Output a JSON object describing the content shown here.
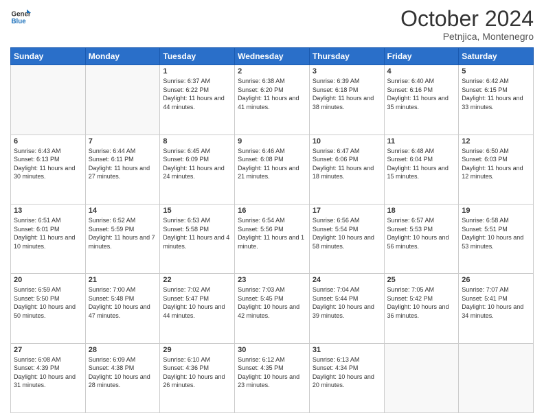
{
  "header": {
    "logo_line1": "General",
    "logo_line2": "Blue",
    "title": "October 2024",
    "location": "Petnjica, Montenegro"
  },
  "weekdays": [
    "Sunday",
    "Monday",
    "Tuesday",
    "Wednesday",
    "Thursday",
    "Friday",
    "Saturday"
  ],
  "weeks": [
    [
      {
        "day": "",
        "empty": true
      },
      {
        "day": "",
        "empty": true
      },
      {
        "day": "1",
        "sunrise": "6:37 AM",
        "sunset": "6:22 PM",
        "daylight": "11 hours and 44 minutes."
      },
      {
        "day": "2",
        "sunrise": "6:38 AM",
        "sunset": "6:20 PM",
        "daylight": "11 hours and 41 minutes."
      },
      {
        "day": "3",
        "sunrise": "6:39 AM",
        "sunset": "6:18 PM",
        "daylight": "11 hours and 38 minutes."
      },
      {
        "day": "4",
        "sunrise": "6:40 AM",
        "sunset": "6:16 PM",
        "daylight": "11 hours and 35 minutes."
      },
      {
        "day": "5",
        "sunrise": "6:42 AM",
        "sunset": "6:15 PM",
        "daylight": "11 hours and 33 minutes."
      }
    ],
    [
      {
        "day": "6",
        "sunrise": "6:43 AM",
        "sunset": "6:13 PM",
        "daylight": "11 hours and 30 minutes."
      },
      {
        "day": "7",
        "sunrise": "6:44 AM",
        "sunset": "6:11 PM",
        "daylight": "11 hours and 27 minutes."
      },
      {
        "day": "8",
        "sunrise": "6:45 AM",
        "sunset": "6:09 PM",
        "daylight": "11 hours and 24 minutes."
      },
      {
        "day": "9",
        "sunrise": "6:46 AM",
        "sunset": "6:08 PM",
        "daylight": "11 hours and 21 minutes."
      },
      {
        "day": "10",
        "sunrise": "6:47 AM",
        "sunset": "6:06 PM",
        "daylight": "11 hours and 18 minutes."
      },
      {
        "day": "11",
        "sunrise": "6:48 AM",
        "sunset": "6:04 PM",
        "daylight": "11 hours and 15 minutes."
      },
      {
        "day": "12",
        "sunrise": "6:50 AM",
        "sunset": "6:03 PM",
        "daylight": "11 hours and 12 minutes."
      }
    ],
    [
      {
        "day": "13",
        "sunrise": "6:51 AM",
        "sunset": "6:01 PM",
        "daylight": "11 hours and 10 minutes."
      },
      {
        "day": "14",
        "sunrise": "6:52 AM",
        "sunset": "5:59 PM",
        "daylight": "11 hours and 7 minutes."
      },
      {
        "day": "15",
        "sunrise": "6:53 AM",
        "sunset": "5:58 PM",
        "daylight": "11 hours and 4 minutes."
      },
      {
        "day": "16",
        "sunrise": "6:54 AM",
        "sunset": "5:56 PM",
        "daylight": "11 hours and 1 minute."
      },
      {
        "day": "17",
        "sunrise": "6:56 AM",
        "sunset": "5:54 PM",
        "daylight": "10 hours and 58 minutes."
      },
      {
        "day": "18",
        "sunrise": "6:57 AM",
        "sunset": "5:53 PM",
        "daylight": "10 hours and 56 minutes."
      },
      {
        "day": "19",
        "sunrise": "6:58 AM",
        "sunset": "5:51 PM",
        "daylight": "10 hours and 53 minutes."
      }
    ],
    [
      {
        "day": "20",
        "sunrise": "6:59 AM",
        "sunset": "5:50 PM",
        "daylight": "10 hours and 50 minutes."
      },
      {
        "day": "21",
        "sunrise": "7:00 AM",
        "sunset": "5:48 PM",
        "daylight": "10 hours and 47 minutes."
      },
      {
        "day": "22",
        "sunrise": "7:02 AM",
        "sunset": "5:47 PM",
        "daylight": "10 hours and 44 minutes."
      },
      {
        "day": "23",
        "sunrise": "7:03 AM",
        "sunset": "5:45 PM",
        "daylight": "10 hours and 42 minutes."
      },
      {
        "day": "24",
        "sunrise": "7:04 AM",
        "sunset": "5:44 PM",
        "daylight": "10 hours and 39 minutes."
      },
      {
        "day": "25",
        "sunrise": "7:05 AM",
        "sunset": "5:42 PM",
        "daylight": "10 hours and 36 minutes."
      },
      {
        "day": "26",
        "sunrise": "7:07 AM",
        "sunset": "5:41 PM",
        "daylight": "10 hours and 34 minutes."
      }
    ],
    [
      {
        "day": "27",
        "sunrise": "6:08 AM",
        "sunset": "4:39 PM",
        "daylight": "10 hours and 31 minutes."
      },
      {
        "day": "28",
        "sunrise": "6:09 AM",
        "sunset": "4:38 PM",
        "daylight": "10 hours and 28 minutes."
      },
      {
        "day": "29",
        "sunrise": "6:10 AM",
        "sunset": "4:36 PM",
        "daylight": "10 hours and 26 minutes."
      },
      {
        "day": "30",
        "sunrise": "6:12 AM",
        "sunset": "4:35 PM",
        "daylight": "10 hours and 23 minutes."
      },
      {
        "day": "31",
        "sunrise": "6:13 AM",
        "sunset": "4:34 PM",
        "daylight": "10 hours and 20 minutes."
      },
      {
        "day": "",
        "empty": true
      },
      {
        "day": "",
        "empty": true
      }
    ]
  ]
}
